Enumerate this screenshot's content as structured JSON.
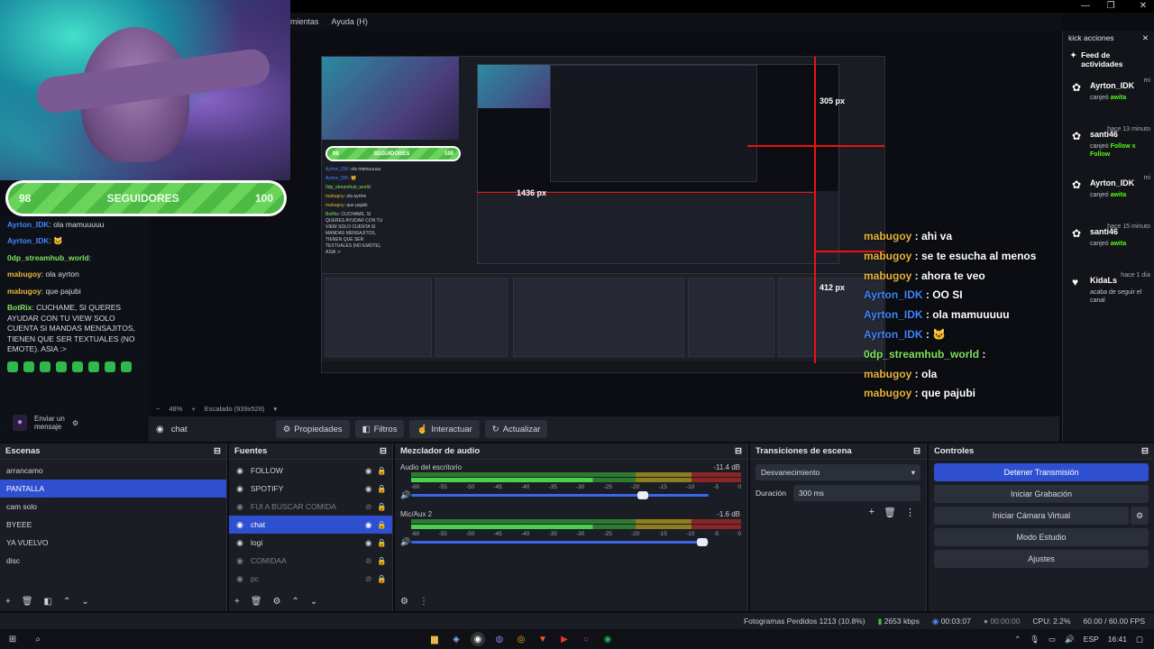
{
  "window": {
    "menu_items": [
      "mientas",
      "Ayuda (H)"
    ],
    "controls": [
      "—",
      "❐",
      "✕"
    ]
  },
  "overlay": {
    "follower_bar": {
      "current": "98",
      "label": "SEGUIDORES",
      "goal": "100",
      "progress": 0.98
    },
    "left_chat": [
      {
        "user": "Ayrton_IDK",
        "text": ": ola mamuuuuu",
        "color": "#3f86ff"
      },
      {
        "user": "Ayrton_IDK",
        "text": ": 🐱",
        "color": "#3f86ff"
      },
      {
        "user": "0dp_streamhub_world",
        "text": ":",
        "color": "#7fe25e"
      },
      {
        "user": "mabugoy",
        "text": ": ola ayrton",
        "color": "#e6b43c"
      },
      {
        "user": "mabugoy",
        "text": ": que pajubi",
        "color": "#e6b43c"
      },
      {
        "user": "BotRix",
        "text": ": CUCHAME, SI QUERES AYUDAR CON TU VIEW SOLO CUENTA SI MANDAS MENSAJITOS, TIENEN QUE SER TEXTUALES (NO EMOTE). ASIA :>",
        "color": "#7fe25e"
      }
    ],
    "chat_input": {
      "send_label": "Enviar un mensaje"
    },
    "right_chat": [
      {
        "user": "mabugoy",
        "text": ": ahi va",
        "color": "#e6b43c"
      },
      {
        "user": "mabugoy",
        "text": ": se te esucha al menos",
        "color": "#e6b43c"
      },
      {
        "user": "mabugoy",
        "text": ": ahora te veo",
        "color": "#e6b43c"
      },
      {
        "user": "Ayrton_IDK",
        "text": ": OO SI",
        "color": "#3f86ff"
      },
      {
        "user": "Ayrton_IDK",
        "text": ": ola mamuuuuu",
        "color": "#3f86ff"
      },
      {
        "user": "Ayrton_IDK",
        "text": ": 🐱",
        "color": "#3f86ff"
      },
      {
        "user": "0dp_streamhub_world",
        "text": ":",
        "color": "#7fe25e"
      },
      {
        "user": "mabugoy",
        "text": ": ola",
        "color": "#e6b43c"
      },
      {
        "user": "mabugoy",
        "text": ": que pajubi",
        "color": "#e6b43c"
      }
    ],
    "preview_labels": {
      "width_px": "1436 px",
      "right_px": "305 px",
      "bottom_px": "412 px"
    }
  },
  "kick": {
    "title": "kick acciones",
    "feed_title": "Feed de actividades",
    "items": [
      {
        "name": "Ayrton_IDK",
        "ago": "mi",
        "action": "canjeó",
        "highlight": "awita"
      },
      {
        "name": "santi46",
        "ago": "hace 13 minuto",
        "action": "canjeó",
        "highlight": "Follow x Follow"
      },
      {
        "name": "Ayrton_IDK",
        "ago": "mi",
        "action": "canjeó",
        "highlight": "awita"
      },
      {
        "name": "santi46",
        "ago": "hace 15 minuto",
        "action": "canjeó",
        "highlight": "awita"
      },
      {
        "name": "KidaLs",
        "ago": "hace 1 día",
        "action": "acaba de seguir el canal",
        "highlight": ""
      }
    ]
  },
  "preview_bar": {
    "zoom": "48%",
    "scale": "Escalado (939x528)"
  },
  "source_toolbar": {
    "selected": "chat",
    "buttons": [
      "Propiedades",
      "Filtros",
      "Interactuar",
      "Actualizar"
    ]
  },
  "scenes": {
    "title": "Escenas",
    "items": [
      "arrancamo",
      "PANTALLA",
      "cam solo",
      "BYEEE",
      "YA VUELVO",
      "disc"
    ],
    "selected_index": 1
  },
  "sources": {
    "title": "Fuentes",
    "items": [
      {
        "name": "FOLLOW",
        "visible": true
      },
      {
        "name": "SPOTIFY",
        "visible": true
      },
      {
        "name": "FUI A BUSCAR COMIDA",
        "visible": false
      },
      {
        "name": "chat",
        "visible": true,
        "selected": true
      },
      {
        "name": "logi",
        "visible": true
      },
      {
        "name": "COMIDAA",
        "visible": false
      },
      {
        "name": "pc",
        "visible": false
      }
    ]
  },
  "mixer": {
    "title": "Mezclador de audio",
    "ticks": [
      "-60",
      "-55",
      "-50",
      "-45",
      "-40",
      "-35",
      "-30",
      "-25",
      "-20",
      "-15",
      "-10",
      "-5",
      "0"
    ],
    "channels": [
      {
        "label": "Audio del escritorio",
        "db": "-11.4 dB",
        "volume": 0.78
      },
      {
        "label": "Mic/Aux 2",
        "db": "-1.6 dB",
        "volume": 0.98
      }
    ]
  },
  "transitions": {
    "title": "Transiciones de escena",
    "selected": "Desvanecimiento",
    "duration_label": "Duración",
    "duration_value": "300 ms"
  },
  "controls": {
    "title": "Controles",
    "buttons": [
      "Detener Transmisión",
      "Iniciar Grabación",
      "Iniciar Cámara Virtual",
      "Modo Estudio",
      "Ajustes"
    ]
  },
  "status": {
    "dropped": "Fotogramas Perdidos 1213 (10.8%)",
    "bitrate": "2653 kbps",
    "stream_time": "00:03:07",
    "rec_time": "00:00:00",
    "cpu": "CPU: 2.2%",
    "fps": "60.00 / 60.00 FPS"
  },
  "taskbar": {
    "lang": "ESP",
    "time": "16:41"
  }
}
